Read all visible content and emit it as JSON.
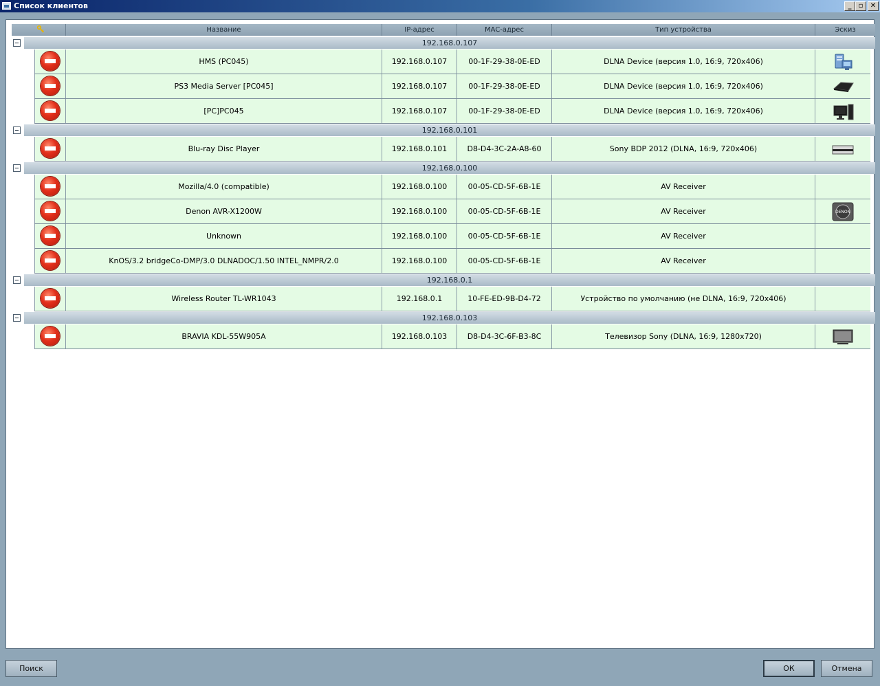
{
  "window": {
    "title": "Список клиентов",
    "minimize": "_",
    "maximize": "▫",
    "close": "✕"
  },
  "columns": {
    "icon": "",
    "name": "Название",
    "ip": "IP-адрес",
    "mac": "MAC-адрес",
    "type": "Тип устройства",
    "thumb": "Эскиз"
  },
  "groups": [
    {
      "label": "192.168.0.107",
      "rows": [
        {
          "name": "HMS (PC045)",
          "ip": "192.168.0.107",
          "mac": "00-1F-29-38-0E-ED",
          "type": "DLNA Device (версия 1.0, 16:9, 720x406)",
          "thumb_icon": "server-icon"
        },
        {
          "name": "PS3 Media Server [PC045]",
          "ip": "192.168.0.107",
          "mac": "00-1F-29-38-0E-ED",
          "type": "DLNA Device (версия 1.0, 16:9, 720x406)",
          "thumb_icon": "ps3-console-icon"
        },
        {
          "name": "[PC]PC045",
          "ip": "192.168.0.107",
          "mac": "00-1F-29-38-0E-ED",
          "type": "DLNA Device (версия 1.0, 16:9, 720x406)",
          "thumb_icon": "desktop-pc-icon"
        }
      ]
    },
    {
      "label": "192.168.0.101",
      "rows": [
        {
          "name": "Blu-ray Disc Player",
          "ip": "192.168.0.101",
          "mac": "D8-D4-3C-2A-A8-60",
          "type": "Sony BDP 2012 (DLNA, 16:9, 720x406)",
          "thumb_icon": "bluray-player-icon"
        }
      ]
    },
    {
      "label": "192.168.0.100",
      "rows": [
        {
          "name": "Mozilla/4.0 (compatible)",
          "ip": "192.168.0.100",
          "mac": "00-05-CD-5F-6B-1E",
          "type": "AV Receiver",
          "thumb_icon": ""
        },
        {
          "name": "Denon AVR-X1200W",
          "ip": "192.168.0.100",
          "mac": "00-05-CD-5F-6B-1E",
          "type": "AV Receiver",
          "thumb_icon": "denon-logo-icon"
        },
        {
          "name": "Unknown",
          "ip": "192.168.0.100",
          "mac": "00-05-CD-5F-6B-1E",
          "type": "AV Receiver",
          "thumb_icon": ""
        },
        {
          "name": "KnOS/3.2 bridgeCo-DMP/3.0 DLNADOC/1.50 INTEL_NMPR/2.0",
          "ip": "192.168.0.100",
          "mac": "00-05-CD-5F-6B-1E",
          "type": "AV Receiver",
          "thumb_icon": ""
        }
      ]
    },
    {
      "label": "192.168.0.1",
      "rows": [
        {
          "name": "Wireless Router TL-WR1043",
          "ip": "192.168.0.1",
          "mac": "10-FE-ED-9B-D4-72",
          "type": "Устройство по умолчанию (не DLNA, 16:9, 720x406)",
          "thumb_icon": ""
        }
      ]
    },
    {
      "label": "192.168.0.103",
      "rows": [
        {
          "name": "BRAVIA KDL-55W905A",
          "ip": "192.168.0.103",
          "mac": "D8-D4-3C-6F-B3-8C",
          "type": "Телевизор Sony (DLNA, 16:9, 1280x720)",
          "thumb_icon": "tv-icon"
        }
      ]
    }
  ],
  "buttons": {
    "search": "Поиск",
    "ok": "ОК",
    "cancel": "Отмена"
  }
}
